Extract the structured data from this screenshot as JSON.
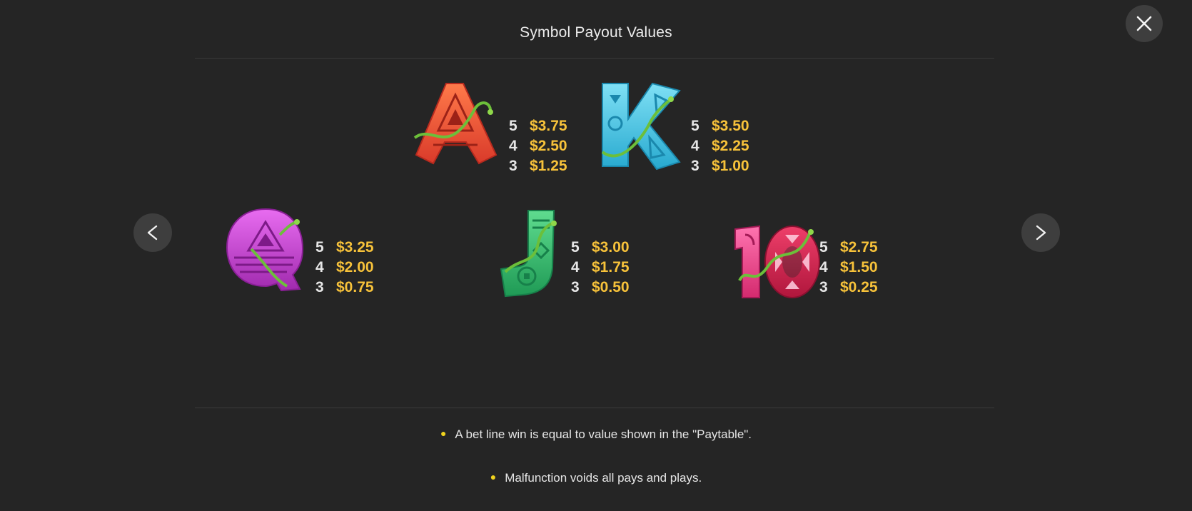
{
  "header": {
    "title": "Symbol Payout Values"
  },
  "controls": {
    "close_icon": "close-icon",
    "prev_icon": "chevron-left-icon",
    "next_icon": "chevron-right-icon"
  },
  "colors": {
    "background": "#252525",
    "payout": "#f7c23a",
    "bullet": "#f0d31e"
  },
  "symbols": [
    {
      "name": "A",
      "color": "#f0553a",
      "payouts": [
        {
          "count": "5",
          "value": "$3.75"
        },
        {
          "count": "4",
          "value": "$2.50"
        },
        {
          "count": "3",
          "value": "$1.25"
        }
      ]
    },
    {
      "name": "K",
      "color": "#3fc1e0",
      "payouts": [
        {
          "count": "5",
          "value": "$3.50"
        },
        {
          "count": "4",
          "value": "$2.25"
        },
        {
          "count": "3",
          "value": "$1.00"
        }
      ]
    },
    {
      "name": "Q",
      "color": "#c93fcf",
      "payouts": [
        {
          "count": "5",
          "value": "$3.25"
        },
        {
          "count": "4",
          "value": "$2.00"
        },
        {
          "count": "3",
          "value": "$0.75"
        }
      ]
    },
    {
      "name": "J",
      "color": "#2fb36a",
      "payouts": [
        {
          "count": "5",
          "value": "$3.00"
        },
        {
          "count": "4",
          "value": "$1.75"
        },
        {
          "count": "3",
          "value": "$0.50"
        }
      ]
    },
    {
      "name": "10",
      "color": "#e0306a",
      "payouts": [
        {
          "count": "5",
          "value": "$2.75"
        },
        {
          "count": "4",
          "value": "$1.50"
        },
        {
          "count": "3",
          "value": "$0.25"
        }
      ]
    }
  ],
  "rules": [
    "A bet line win is equal to value shown in the \"Paytable\".",
    "Malfunction voids all pays and plays."
  ]
}
